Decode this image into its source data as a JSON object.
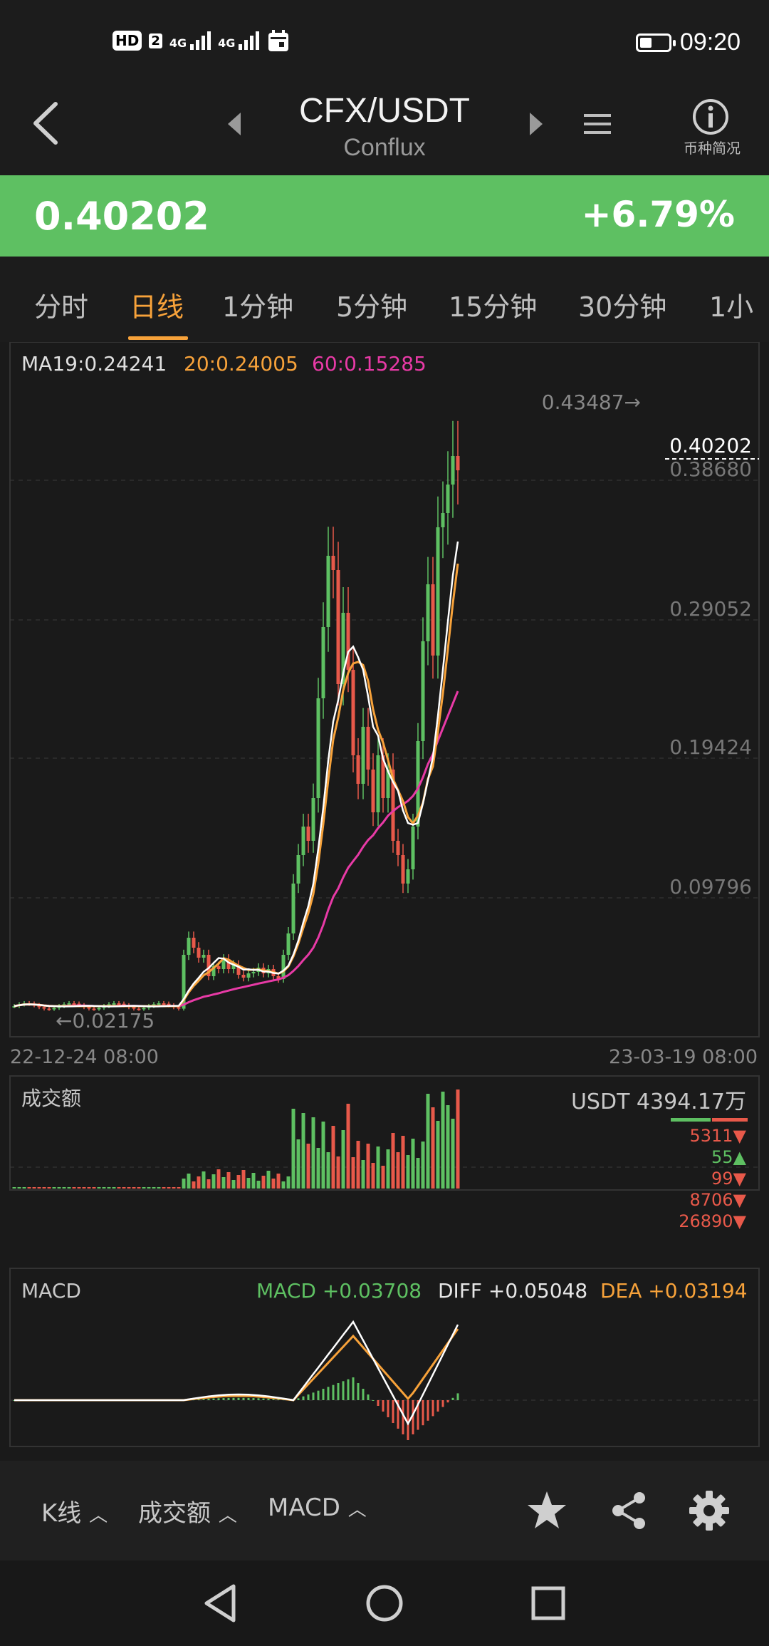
{
  "status_bar": {
    "time": "09:20",
    "hd_badge": "HD",
    "sim_badge": "2",
    "network_1": "4G",
    "network_2": "4G",
    "battery_level": 0.4
  },
  "nav": {
    "pair": "CFX/USDT",
    "name": "Conflux",
    "info_label": "币种简况"
  },
  "price": {
    "last": "0.40202",
    "change_pct": "+6.79%"
  },
  "tabs": [
    "分时",
    "日线",
    "1分钟",
    "5分钟",
    "15分钟",
    "30分钟",
    "1小"
  ],
  "active_tab": 1,
  "main_chart": {
    "ma_labels": {
      "ma19": "MA19:0.24241",
      "ma20": "20:0.24005",
      "ma60": "60:0.15285"
    },
    "y_ticks": [
      "0.38680",
      "0.29052",
      "0.19424",
      "0.09796"
    ],
    "high_marker": "0.43487→",
    "low_marker": "←0.02175",
    "current_price": "0.40202",
    "date_start": "22-12-24 08:00",
    "date_end": "23-03-19 08:00",
    "colors": {
      "up": "#5ec062",
      "down": "#e8594a",
      "ma19": "#ffffff",
      "ma20": "#f7a23a",
      "ma60": "#e83aa6"
    }
  },
  "volume_panel": {
    "title": "成交额",
    "total": "USDT 4394.17万",
    "list": [
      {
        "value": "5311",
        "dir": "down"
      },
      {
        "value": "55",
        "dir": "up"
      },
      {
        "value": "99",
        "dir": "down"
      },
      {
        "value": "8706",
        "dir": "down"
      },
      {
        "value": "26890",
        "dir": "down"
      }
    ]
  },
  "macd_panel": {
    "title": "MACD",
    "macd": "MACD +0.03708",
    "diff": "DIFF +0.05048",
    "dea": "DEA +0.03194"
  },
  "bottom_bar": {
    "kline": "K线",
    "volume": "成交额",
    "macd": "MACD"
  }
}
